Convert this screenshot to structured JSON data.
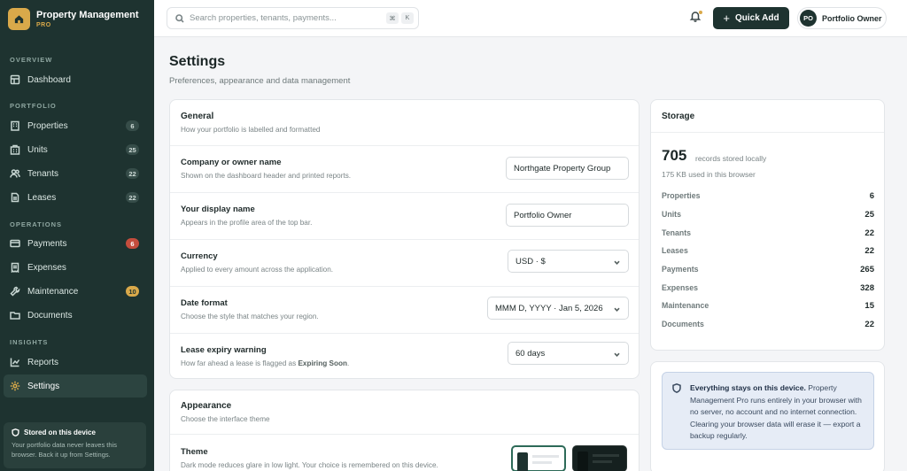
{
  "sidebar": {
    "brand_name": "Property Management",
    "brand_sub": "PRO",
    "sections": {
      "overview": "OVERVIEW",
      "portfolio": "PORTFOLIO",
      "operations": "OPERATIONS",
      "insights": "INSIGHTS"
    },
    "items": [
      {
        "label": "Dashboard",
        "icon": "dashboard-icon"
      },
      {
        "label": "Properties",
        "badge": "6",
        "icon": "building-icon"
      },
      {
        "label": "Units",
        "badge": "25",
        "icon": "units-icon"
      },
      {
        "label": "Tenants",
        "badge": "22",
        "icon": "users-icon"
      },
      {
        "label": "Leases",
        "badge": "22",
        "icon": "document-icon"
      },
      {
        "label": "Payments",
        "badge": "6",
        "icon": "card-icon"
      },
      {
        "label": "Expenses",
        "icon": "receipt-icon"
      },
      {
        "label": "Maintenance",
        "badge": "10",
        "icon": "wrench-icon"
      },
      {
        "label": "Documents",
        "icon": "folder-icon"
      },
      {
        "label": "Reports",
        "icon": "chart-icon"
      },
      {
        "label": "Settings",
        "icon": "gear-icon"
      }
    ],
    "device_title": "Stored on this device",
    "device_text": "Your portfolio data never leaves this browser. Back it up from Settings."
  },
  "topbar": {
    "search_placeholder": "Search properties, tenants, payments...",
    "kbd_cmd": "⌘",
    "kbd_k": "K",
    "quick_add": "Quick Add",
    "user_initials": "PO",
    "user_name": "Portfolio Owner"
  },
  "page": {
    "title": "Settings",
    "subtitle": "Preferences, appearance and data management"
  },
  "general": {
    "title": "General",
    "subtitle": "How your portfolio is labelled and formatted",
    "rows": [
      {
        "label": "Company or owner name",
        "hint": "Shown on the dashboard header and printed reports.",
        "value": "Northgate Property Group"
      },
      {
        "label": "Your display name",
        "hint": "Appears in the profile area of the top bar.",
        "value": "Portfolio Owner"
      },
      {
        "label": "Currency",
        "hint": "Applied to every amount across the application.",
        "value": "USD · $"
      },
      {
        "label": "Date format",
        "hint": "Choose the style that matches your region.",
        "value": "MMM D, YYYY · Jan 5, 2026"
      },
      {
        "label": "Lease expiry warning",
        "hint_pre": "How far ahead a lease is flagged as ",
        "hint_bold": "Expiring Soon",
        "hint_post": ".",
        "value": "60 days"
      }
    ]
  },
  "appearance": {
    "title": "Appearance",
    "subtitle": "Choose the interface theme",
    "theme_label": "Theme",
    "theme_hint": "Dark mode reduces glare in low light. Your choice is remembered on this device."
  },
  "storage": {
    "title": "Storage",
    "records": "705",
    "records_label": "records stored locally",
    "size": "175 KB used in this browser",
    "items": [
      {
        "label": "Properties",
        "value": "6"
      },
      {
        "label": "Units",
        "value": "25"
      },
      {
        "label": "Tenants",
        "value": "22"
      },
      {
        "label": "Leases",
        "value": "22"
      },
      {
        "label": "Payments",
        "value": "265"
      },
      {
        "label": "Expenses",
        "value": "328"
      },
      {
        "label": "Maintenance",
        "value": "15"
      },
      {
        "label": "Documents",
        "value": "22"
      }
    ],
    "info_bold": "Everything stays on this device.",
    "info_text": " Property Management Pro runs entirely in your browser with no server, no account and no internet connection. Clearing your browser data will erase it — export a backup regularly."
  },
  "colors": {
    "sidebar": "#1e3330",
    "accent": "#d9a94a",
    "danger": "#c44d3d"
  }
}
